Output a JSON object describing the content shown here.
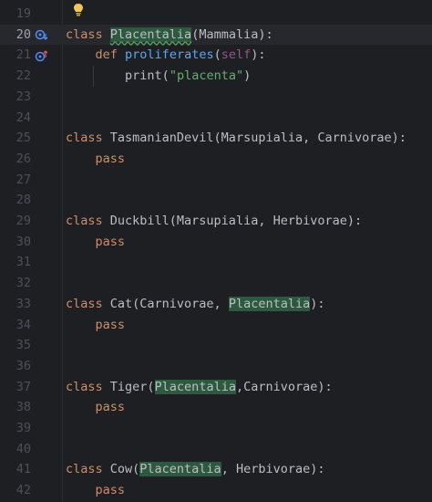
{
  "editor": {
    "lines": [
      {
        "num": "19"
      },
      {
        "num": "20",
        "current": true
      },
      {
        "num": "21"
      },
      {
        "num": "22"
      },
      {
        "num": "23"
      },
      {
        "num": "24"
      },
      {
        "num": "25"
      },
      {
        "num": "26"
      },
      {
        "num": "27"
      },
      {
        "num": "28"
      },
      {
        "num": "29"
      },
      {
        "num": "30"
      },
      {
        "num": "31"
      },
      {
        "num": "32"
      },
      {
        "num": "33"
      },
      {
        "num": "34"
      },
      {
        "num": "35"
      },
      {
        "num": "36"
      },
      {
        "num": "37"
      },
      {
        "num": "38"
      },
      {
        "num": "39"
      },
      {
        "num": "40"
      },
      {
        "num": "41"
      },
      {
        "num": "42"
      }
    ],
    "code": {
      "kw_class": "class",
      "kw_def": "def",
      "kw_pass": "pass",
      "placentalia": "Placentalia",
      "l20_rest": "(Mammalia):",
      "l21_fn": "proliferates",
      "l21_open": "(",
      "l21_self": "self",
      "l21_close": "):",
      "l22_print": "print(",
      "l22_str": "\"placenta\"",
      "l22_close": ")",
      "l25_rest": " TasmanianDevil(Marsupialia, Carnivorae):",
      "l29_rest": " Duckbill(Marsupialia, Herbivorae):",
      "l33_pre": " Cat(Carnivorae, ",
      "l33_post": "):",
      "l37_pre": " Tiger(",
      "l37_post": ",Carnivorae):",
      "l41_pre": " Cow(",
      "l41_post": ", Herbivorae):"
    },
    "markers": {
      "line20": "overridden-method-icon",
      "line21": "overriding-method-icon",
      "bulb": "lightbulb-icon"
    },
    "colors": {
      "keyword": "#cf8e6d",
      "function": "#56a8f5",
      "self": "#94558d",
      "string": "#6aab73",
      "highlight": "#2d5a3f"
    }
  }
}
